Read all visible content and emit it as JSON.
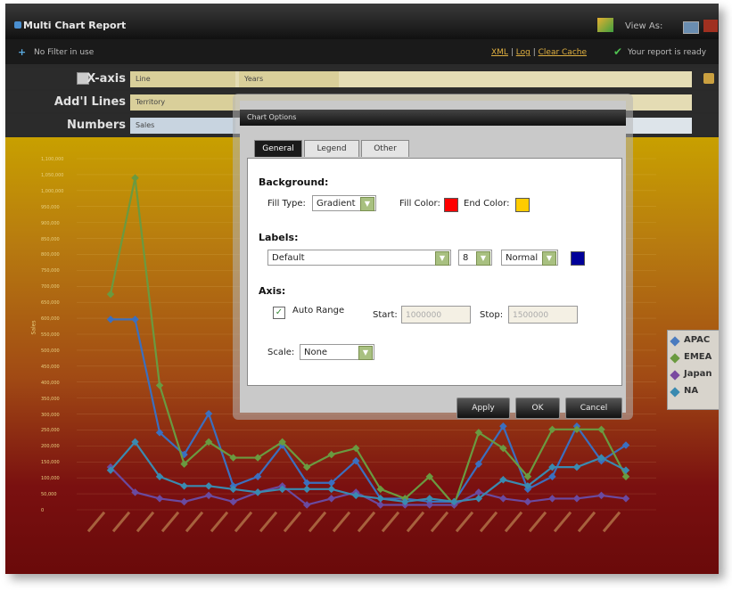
{
  "app": {
    "title": "Multi Chart Report",
    "view_as_label": "View As:"
  },
  "subbar": {
    "filter_text": "No Filter in use",
    "links": {
      "xml": "XML",
      "log": "Log",
      "clear_cache": "Clear Cache"
    },
    "separator": "|",
    "status": "Your report is ready"
  },
  "fields": {
    "xaxis": {
      "label": "X-axis",
      "value1": "Line",
      "value2": "Years"
    },
    "addl_lines": {
      "label": "Add'l Lines",
      "value": "Territory"
    },
    "numbers": {
      "label": "Numbers",
      "value": "Sales"
    }
  },
  "chart": {
    "ylabel": "Sales",
    "yticks": [
      "1,100,000",
      "1,050,000",
      "1,000,000",
      "950,000",
      "900,000",
      "850,000",
      "800,000",
      "750,000",
      "700,000",
      "650,000",
      "600,000",
      "550,000",
      "500,000",
      "450,000",
      "400,000",
      "350,000",
      "300,000",
      "250,000",
      "200,000",
      "150,000",
      "100,000",
      "50,000",
      "0"
    ],
    "legend": [
      {
        "name": "APAC",
        "color": "#4a7bbf"
      },
      {
        "name": "EMEA",
        "color": "#6a9a40"
      },
      {
        "name": "Japan",
        "color": "#7a4aa0"
      },
      {
        "name": "NA",
        "color": "#3a8ab0"
      }
    ]
  },
  "chart_data": {
    "type": "line",
    "ylabel": "Sales",
    "ylim": [
      0,
      1100000
    ],
    "x_count": 22,
    "series": [
      {
        "name": "APAC",
        "color": "#3b6fbf",
        "values": [
          600000,
          600000,
          240000,
          170000,
          300000,
          70000,
          100000,
          200000,
          80000,
          80000,
          150000,
          30000,
          30000,
          20000,
          20000,
          140000,
          260000,
          60000,
          100000,
          260000,
          150000,
          200000
        ]
      },
      {
        "name": "EMEA",
        "color": "#6a9a40",
        "values": [
          680000,
          1050000,
          390000,
          140000,
          210000,
          160000,
          160000,
          210000,
          130000,
          170000,
          190000,
          60000,
          30000,
          100000,
          10000,
          240000,
          190000,
          100000,
          250000,
          250000,
          250000,
          100000
        ]
      },
      {
        "name": "Japan",
        "color": "#6a4aa0",
        "values": [
          130000,
          50000,
          30000,
          20000,
          40000,
          20000,
          50000,
          70000,
          10000,
          30000,
          50000,
          10000,
          10000,
          10000,
          10000,
          50000,
          30000,
          20000,
          30000,
          30000,
          40000,
          30000
        ]
      },
      {
        "name": "NA",
        "color": "#3a8ab0",
        "values": [
          120000,
          210000,
          100000,
          70000,
          70000,
          60000,
          50000,
          60000,
          60000,
          60000,
          40000,
          30000,
          20000,
          30000,
          20000,
          30000,
          90000,
          70000,
          130000,
          130000,
          160000,
          120000
        ]
      }
    ]
  },
  "dialog": {
    "title": "Chart Options",
    "tabs": [
      "General",
      "Legend",
      "Other"
    ],
    "background": {
      "heading": "Background:",
      "fill_type_label": "Fill Type:",
      "fill_type_value": "Gradient",
      "fill_color_label": "Fill Color:",
      "fill_color": "#ff0000",
      "end_color_label": "End Color:",
      "end_color": "#ffcc00"
    },
    "labels": {
      "heading": "Labels:",
      "font_value": "Default",
      "size_value": "8",
      "style_value": "Normal",
      "color": "#000099"
    },
    "axis": {
      "heading": "Axis:",
      "auto_range_label": "Auto Range",
      "auto_range_checked": "✓",
      "start_label": "Start:",
      "start_value": "1000000",
      "stop_label": "Stop:",
      "stop_value": "1500000",
      "scale_label": "Scale:",
      "scale_value": "None"
    },
    "buttons": {
      "apply": "Apply",
      "ok": "OK",
      "cancel": "Cancel"
    }
  }
}
